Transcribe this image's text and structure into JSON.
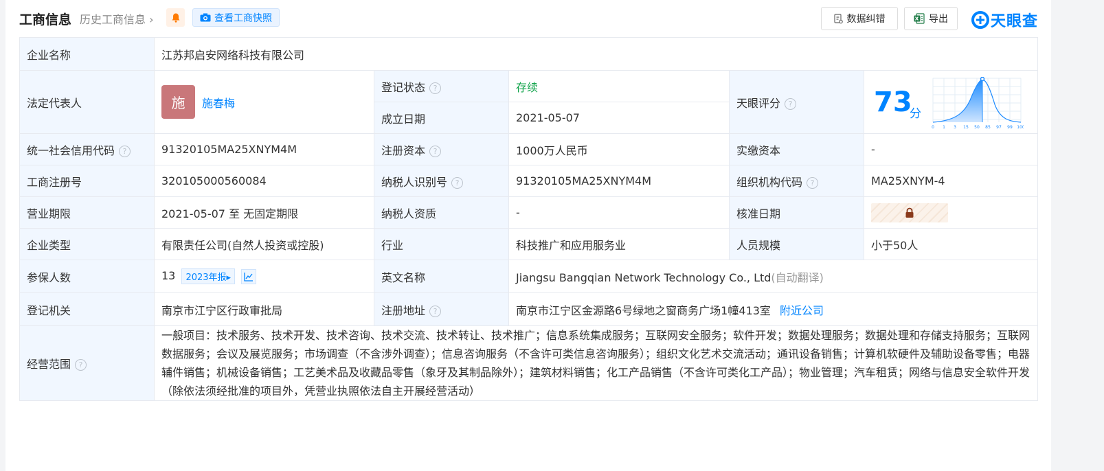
{
  "header": {
    "title": "工商信息",
    "history": "历史工商信息",
    "snapshot_button": "查看工商快照",
    "correct_button": "数据纠错",
    "export_button": "导出",
    "logo": "天眼查"
  },
  "rows": {
    "company_name": {
      "label": "企业名称",
      "value": "江苏邦启安网络科技有限公司"
    },
    "legal_rep": {
      "label": "法定代表人",
      "avatar": "施",
      "name": "施春梅"
    },
    "reg_status": {
      "label": "登记状态",
      "value": "存续",
      "color": "#10a34a"
    },
    "found_date": {
      "label": "成立日期",
      "value": "2021-05-07"
    },
    "tianyan_score": {
      "label": "天眼评分",
      "score": "73",
      "unit": "分",
      "ticks": [
        "0",
        "1",
        "3",
        "15",
        "50",
        "85",
        "97",
        "99",
        "100"
      ]
    },
    "credit_code": {
      "label": "统一社会信用代码",
      "value": "91320105MA25XNYM4M"
    },
    "reg_capital": {
      "label": "注册资本",
      "value": "1000万人民币"
    },
    "paid_capital": {
      "label": "实缴资本",
      "value": "-"
    },
    "reg_number": {
      "label": "工商注册号",
      "value": "320105000560084"
    },
    "taxpayer_id": {
      "label": "纳税人识别号",
      "value": "91320105MA25XNYM4M"
    },
    "org_code": {
      "label": "组织机构代码",
      "value": "MA25XNYM-4"
    },
    "biz_term": {
      "label": "营业期限",
      "value": "2021-05-07 至 无固定期限"
    },
    "taxpayer_qual": {
      "label": "纳税人资质",
      "value": "-"
    },
    "approve_date": {
      "label": "核准日期",
      "locked_icon": "lock-icon"
    },
    "company_type": {
      "label": "企业类型",
      "value": "有限责任公司(自然人投资或控股)"
    },
    "industry": {
      "label": "行业",
      "value": "科技推广和应用服务业"
    },
    "staff_size": {
      "label": "人员规模",
      "value": "小于50人"
    },
    "insured": {
      "label": "参保人数",
      "value": "13",
      "report": "2023年报"
    },
    "english_name": {
      "label": "英文名称",
      "value": "Jiangsu Bangqian Network Technology Co., Ltd",
      "note": "(自动翻译)"
    },
    "reg_authority": {
      "label": "登记机关",
      "value": "南京市江宁区行政审批局"
    },
    "reg_address": {
      "label": "注册地址",
      "value": "南京市江宁区金源路6号绿地之窗商务广场1幢413室",
      "link": "附近公司"
    },
    "scope": {
      "label": "经营范围",
      "value": "一般项目：技术服务、技术开发、技术咨询、技术交流、技术转让、技术推广；信息系统集成服务；互联网安全服务；软件开发；数据处理服务；数据处理和存储支持服务；互联网数据服务；会议及展览服务；市场调查（不含涉外调查）；信息咨询服务（不含许可类信息咨询服务）；组织文化艺术交流活动；通讯设备销售；计算机软硬件及辅助设备零售；电器辅件销售；机械设备销售；工艺美术品及收藏品零售（象牙及其制品除外）；建筑材料销售；化工产品销售（不含许可类化工产品）；物业管理；汽车租赁；网络与信息安全软件开发（除依法须经批准的项目外，凭营业执照依法自主开展经营活动）"
    }
  }
}
